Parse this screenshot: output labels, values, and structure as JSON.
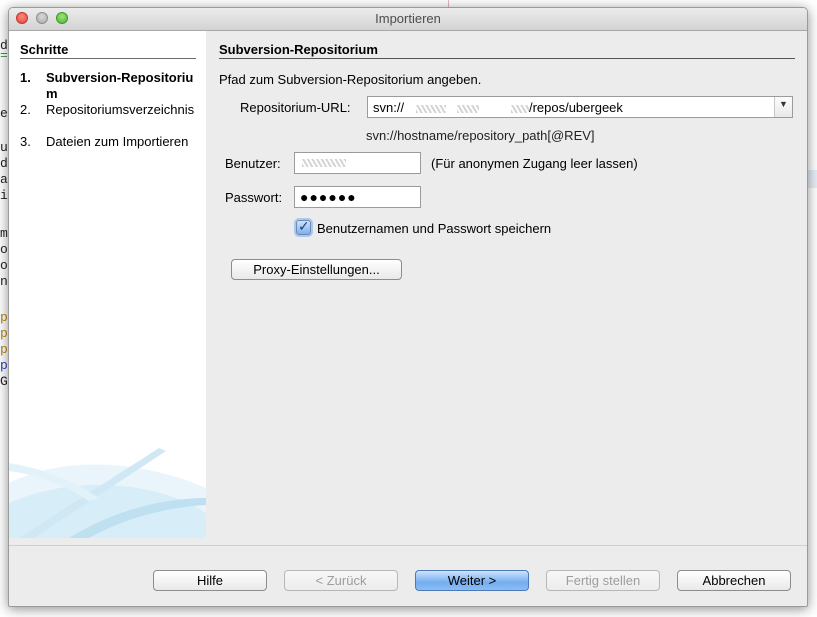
{
  "window": {
    "title": "Importieren"
  },
  "background_editor": {
    "lines": [
      "d",
      "=",
      "e",
      "u",
      "d",
      "a",
      "i",
      "m",
      "o",
      "o",
      "n",
      "p",
      "p",
      "p",
      "p",
      "G"
    ]
  },
  "steps": {
    "title": "Schritte",
    "items": [
      {
        "number": "1.",
        "label": "Subversion-Repositorium",
        "active": true
      },
      {
        "number": "2.",
        "label": "Repositoriumsverzeichnis",
        "active": false
      },
      {
        "number": "3.",
        "label": "Dateien zum Importieren",
        "active": false
      }
    ]
  },
  "main": {
    "title": "Subversion-Repositorium",
    "instruction": "Pfad zum Subversion-Repositorium angeben.",
    "repository_url": {
      "label": "Repositorium-URL:",
      "value_prefix": "svn://",
      "value_suffix": "/repos/ubergeek",
      "hint": "svn://hostname/repository_path[@REV]"
    },
    "user": {
      "label": "Benutzer:",
      "hint": "(Für anonymen Zugang leer lassen)"
    },
    "password": {
      "label": "Passwort:",
      "value": "●●●●●●"
    },
    "save_credentials": {
      "label": "Benutzernamen und Passwort speichern",
      "checked": true
    },
    "proxy_button": "Proxy-Einstellungen..."
  },
  "footer": {
    "help": "Hilfe",
    "back": "< Zurück",
    "next": "Weiter >",
    "finish": "Fertig stellen",
    "cancel": "Abbrechen"
  },
  "colors": {
    "default_button": "#74aef0",
    "window_background": "#ececec",
    "sidebar_background": "#ffffff",
    "swoosh": "#bfe0f0"
  },
  "icons": {
    "dropdown": "chevron-down-icon",
    "checkbox": "checkmark-icon"
  }
}
